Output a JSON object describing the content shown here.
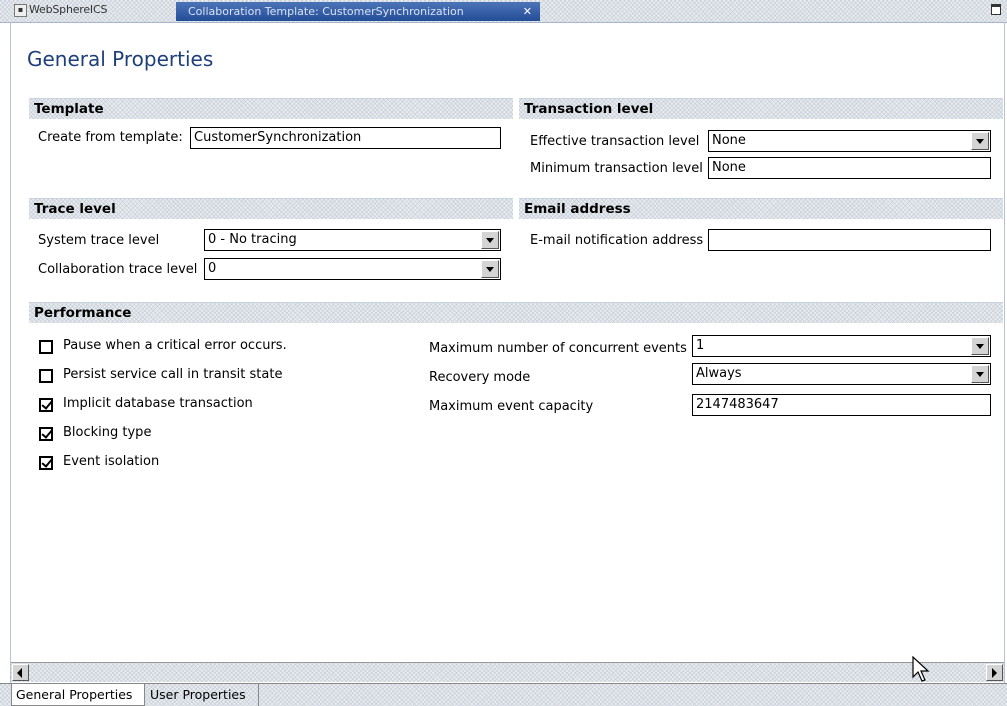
{
  "tabs": {
    "inactive_label": "WebSphereICS",
    "active_label": "Collaboration Template: CustomerSynchronization",
    "close_symbol": "✕"
  },
  "page_title": "General Properties",
  "template": {
    "heading": "Template",
    "create_label": "Create from template:",
    "create_value": "CustomerSynchronization"
  },
  "transaction": {
    "heading": "Transaction level",
    "effective_label": "Effective transaction level",
    "effective_value": "None",
    "minimum_label": "Minimum transaction level",
    "minimum_value": "None"
  },
  "trace": {
    "heading": "Trace level",
    "system_label": "System trace level",
    "system_value": "0 - No tracing",
    "collab_label": "Collaboration trace level",
    "collab_value": "0"
  },
  "email": {
    "heading": "Email address",
    "label": "E-mail notification address",
    "value": ""
  },
  "performance": {
    "heading": "Performance",
    "checkboxes": [
      {
        "label": "Pause when a critical error occurs.",
        "checked": false
      },
      {
        "label": "Persist service call in transit state",
        "checked": false
      },
      {
        "label": "Implicit database transaction",
        "checked": true
      },
      {
        "label": "Blocking type",
        "checked": true
      },
      {
        "label": "Event isolation",
        "checked": true
      }
    ],
    "max_events_label": "Maximum number of concurrent events",
    "max_events_value": "1",
    "recovery_label": "Recovery mode",
    "recovery_value": "Always",
    "capacity_label": "Maximum event capacity",
    "capacity_value": "2147483647"
  },
  "bottom_tabs": {
    "general": "General Properties",
    "user": "User Properties"
  },
  "colors": {
    "title_blue": "#1e3f7a",
    "active_tab": "#244d97"
  }
}
